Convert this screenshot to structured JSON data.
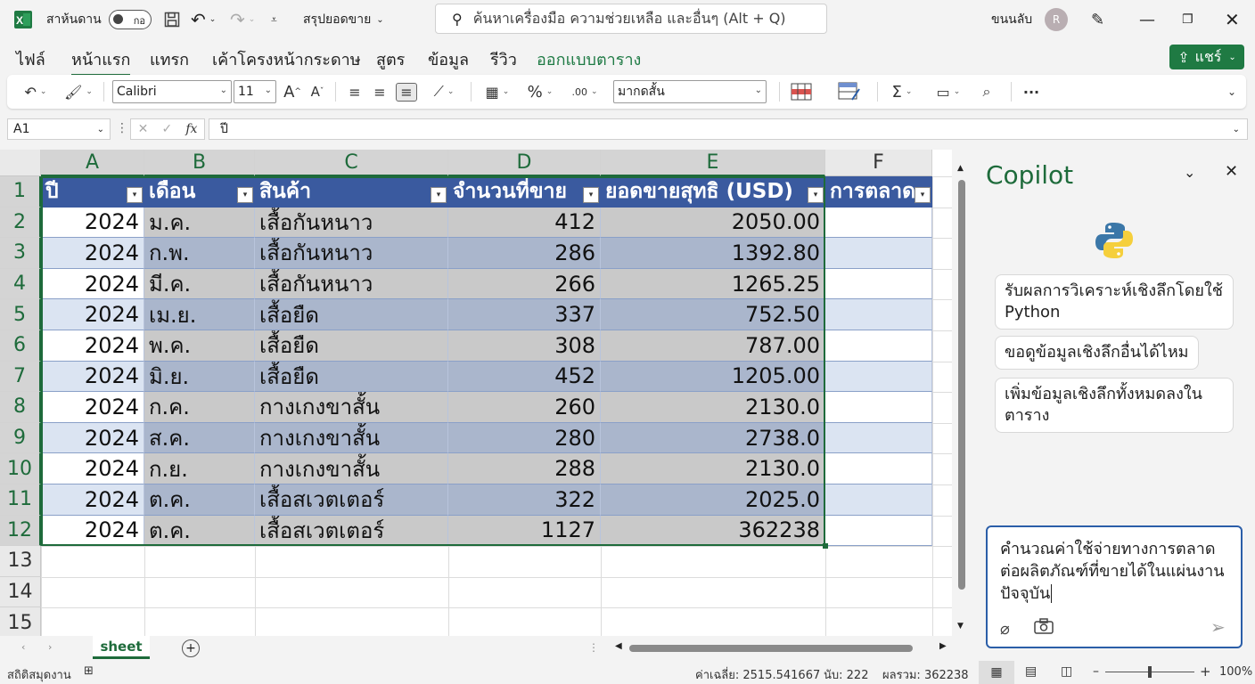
{
  "titlebar": {
    "autosave_label": "สาห้นดาน",
    "toggle_state": "กอ",
    "filename": "สรุปยอดขาย",
    "search_placeholder": "ค้นหาเครื่องมือ ความช่วยเหลือ และอื่นๆ (Alt + Q)",
    "user_name": "ขนนลับ",
    "avatar_initial": "R"
  },
  "menu": {
    "tabs": [
      "ไฟล์",
      "หน้าแรก",
      "แทรก",
      "เค้าโครงหน้ากระดาษ",
      "สูตร",
      "ข้อมูล",
      "รีวิว",
      "ออกแบบตาราง"
    ],
    "active_tab": "หน้าแรก",
    "share_label": "แชร์"
  },
  "ribbon": {
    "font_name": "Calibri",
    "font_size": "11",
    "number_format": "มากดสั้น"
  },
  "formula_bar": {
    "cell_ref": "A1",
    "fx": "fx",
    "content": "ปี"
  },
  "grid": {
    "columns": [
      "A",
      "B",
      "C",
      "D",
      "E",
      "F"
    ],
    "row_numbers": [
      "1",
      "2",
      "3",
      "4",
      "5",
      "6",
      "7",
      "8",
      "9",
      "10",
      "11",
      "12",
      "13",
      "14",
      "15"
    ],
    "headers": [
      "ปี",
      "เดือน",
      "สินค้า",
      "จำนวนที่ขาย",
      "ยอดขายสุทธิ (USD)",
      "การตลาด"
    ],
    "rows": [
      [
        "2024",
        "ม.ค.",
        "เสื้อกันหนาว",
        "412",
        "2050.00"
      ],
      [
        "2024",
        "ก.พ.",
        "เสื้อกันหนาว",
        "286",
        "1392.80"
      ],
      [
        "2024",
        "มี.ค.",
        "เสื้อกันหนาว",
        "266",
        "1265.25"
      ],
      [
        "2024",
        "เม.ย.",
        "เสื้อยืด",
        "337",
        "752.50"
      ],
      [
        "2024",
        "พ.ค.",
        "เสื้อยืด",
        "308",
        "787.00"
      ],
      [
        "2024",
        "มิ.ย.",
        "เสื้อยืด",
        "452",
        "1205.00"
      ],
      [
        "2024",
        "ก.ค.",
        "กางเกงขาสั้น",
        "260",
        "2130.0"
      ],
      [
        "2024",
        "ส.ค.",
        "กางเกงขาสั้น",
        "280",
        "2738.0"
      ],
      [
        "2024",
        "ก.ย.",
        "กางเกงขาสั้น",
        "288",
        "2130.0"
      ],
      [
        "2024",
        "ต.ค.",
        "เสื้อสเวตเตอร์",
        "322",
        "2025.0"
      ],
      [
        "2024",
        "ต.ค.",
        "เสื้อสเวตเตอร์",
        "1127",
        "362238"
      ]
    ]
  },
  "copilot": {
    "title": "Copilot",
    "suggestions": [
      "รับผลการวิเคราะห์เชิงลึกโดยใช้ Python",
      "ขอดูข้อมูลเชิงลึกอื่นได้ไหม",
      "เพิ่มข้อมูลเชิงลึกทั้งหมดลงในตาราง"
    ],
    "prompt_text": "คำนวณค่าใช้จ่ายทางการตลาดต่อผลิตภัณฑ์ที่ขายได้ในแผ่นงานปัจจุบัน"
  },
  "sheets": {
    "tabs": [
      "sheet"
    ]
  },
  "status": {
    "ready": "สถิติสมุดงาน",
    "average": "ค่าเฉลี่ย: 2515.541667",
    "count": "นับ: 222",
    "sum": "ผลรวม: 362238",
    "zoom": "100%"
  },
  "colors": {
    "accent_green": "#1f7a43",
    "table_header": "#3a5a9f",
    "band": "#dbe4f2"
  }
}
